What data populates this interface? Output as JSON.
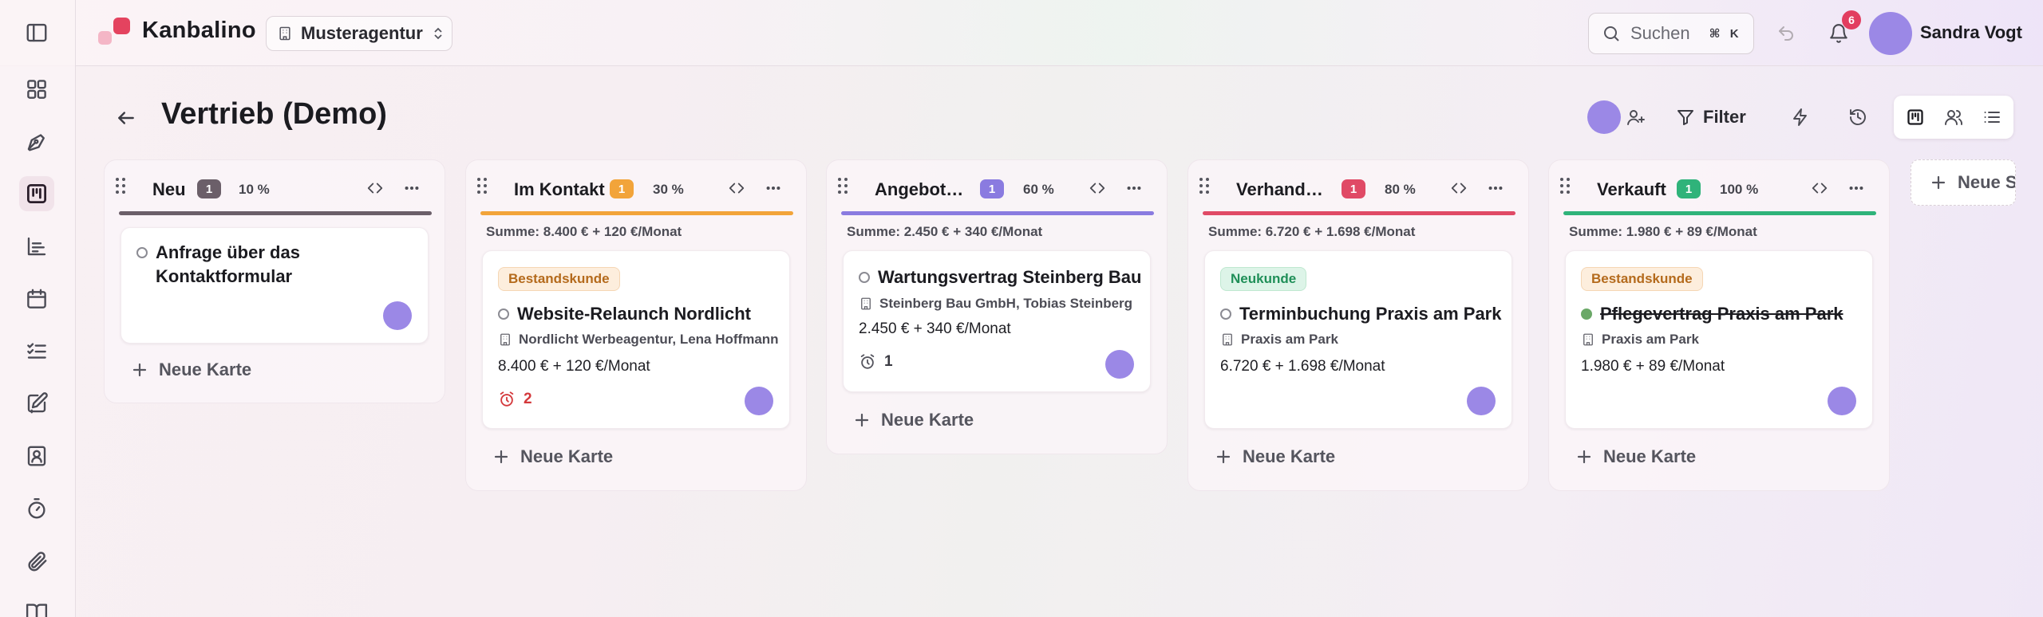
{
  "app": {
    "name": "Kanbalino",
    "workspace": "Musteragentur"
  },
  "search": {
    "label": "Suchen",
    "shortcut": "⌘ K"
  },
  "notifications": {
    "count": "6"
  },
  "user": {
    "name": "Sandra Vogt"
  },
  "page": {
    "title": "Vertrieb (Demo)"
  },
  "toolbar": {
    "filter_label": "Filter"
  },
  "colors": {
    "brand": "#e4435f",
    "avatar": "#9b88e6",
    "neu": "#6b5f69",
    "im_kontakt": "#f2a43a",
    "angebot": "#8a7be0",
    "verhandlung": "#e04a66",
    "verkauft": "#2fb37a"
  },
  "board": {
    "new_card_label": "Neue Karte",
    "new_column_label": "Neue Spalte",
    "columns": [
      {
        "title": "Neu",
        "count": "1",
        "percent": "10 %",
        "sum": "",
        "cards": [
          {
            "tag": "",
            "title": "Anfrage über das Kontaktformular",
            "done": false,
            "company": "",
            "amount": "",
            "reminder": ""
          }
        ]
      },
      {
        "title": "Im Kontakt",
        "count": "1",
        "percent": "30 %",
        "sum": "Summe: 8.400 € + 120 €/Monat",
        "cards": [
          {
            "tag": "Bestandskunde",
            "title": "Website-Relaunch Nordlicht",
            "done": false,
            "company": "Nordlicht Werbeagentur, Lena Hoffmann",
            "amount": "8.400 € + 120 €/Monat",
            "reminder": "2"
          }
        ]
      },
      {
        "title": "Angebot erstellt",
        "count": "1",
        "percent": "60 %",
        "sum": "Summe: 2.450 € + 340 €/Monat",
        "cards": [
          {
            "tag": "",
            "title": "Wartungsvertrag Steinberg Bau",
            "done": false,
            "company": "Steinberg Bau GmbH, Tobias Steinberg",
            "amount": "2.450 € + 340 €/Monat",
            "reminder": "1"
          }
        ]
      },
      {
        "title": "Verhandlung",
        "count": "1",
        "percent": "80 %",
        "sum": "Summe: 6.720 € + 1.698 €/Monat",
        "cards": [
          {
            "tag": "Neukunde",
            "title": "Terminbuchung Praxis am Park",
            "done": false,
            "company": "Praxis am Park",
            "amount": "6.720 € + 1.698 €/Monat",
            "reminder": ""
          }
        ]
      },
      {
        "title": "Verkauft",
        "count": "1",
        "percent": "100 %",
        "sum": "Summe: 1.980 € + 89 €/Monat",
        "cards": [
          {
            "tag": "Bestandskunde",
            "title": "Pflegevertrag Praxis am Park",
            "done": true,
            "company": "Praxis am Park",
            "amount": "1.980 € + 89 €/Monat",
            "reminder": ""
          }
        ]
      }
    ]
  }
}
